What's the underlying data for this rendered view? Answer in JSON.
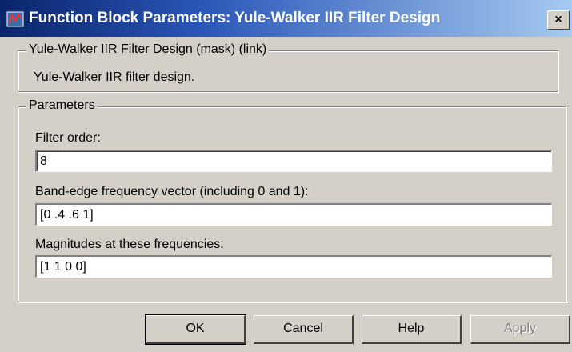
{
  "window": {
    "title": "Function Block Parameters: Yule-Walker IIR Filter Design",
    "close_label": "×"
  },
  "mask_group": {
    "legend": "Yule-Walker IIR Filter Design (mask) (link)",
    "description": "Yule-Walker IIR filter design."
  },
  "parameters": {
    "legend": "Parameters",
    "fields": [
      {
        "label": "Filter order:",
        "value": "8"
      },
      {
        "label": "Band-edge frequency vector (including 0 and 1):",
        "value": "[0 .4 .6 1]"
      },
      {
        "label": "Magnitudes at these frequencies:",
        "value": "[1 1 0 0]"
      }
    ]
  },
  "buttons": {
    "ok": "OK",
    "cancel": "Cancel",
    "help": "Help",
    "apply": "Apply"
  },
  "icons": {
    "title": "simulink-block-icon"
  }
}
